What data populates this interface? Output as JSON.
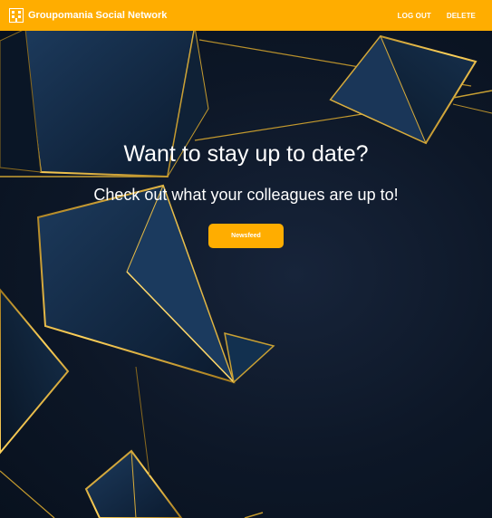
{
  "navbar": {
    "brand_text": "Groupomania Social Network",
    "logo_icon": "building-logo-icon",
    "links": {
      "logout_label": "LOG OUT",
      "delete_label": "DELETE"
    },
    "background_color": "#ffad00"
  },
  "hero": {
    "title": "Want to stay up to date?",
    "subtitle": "Check out what your colleagues are up to!",
    "button_label": "Newsfeed",
    "background_color": "#0c1626",
    "accent_color": "#d4a72c"
  }
}
